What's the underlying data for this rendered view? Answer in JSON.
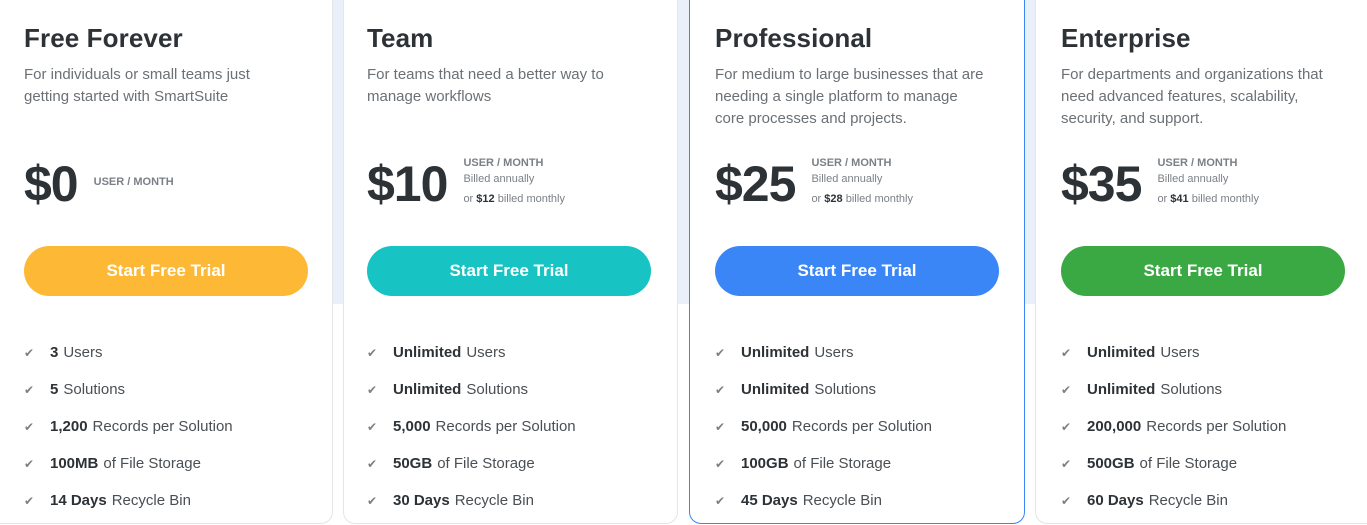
{
  "plans": [
    {
      "name": "Free Forever",
      "description": "For individuals or small teams just getting started with SmartSuite",
      "price": "$0",
      "unit": "USER / MONTH",
      "billed": "",
      "monthly_prefix": "",
      "monthly_price": "",
      "monthly_suffix": "",
      "cta": "Start Free Trial",
      "cta_color": "#fdb835",
      "featured": false,
      "features": [
        {
          "bold": "3",
          "text": "Users"
        },
        {
          "bold": "5",
          "text": "Solutions"
        },
        {
          "bold": "1,200",
          "text": "Records per Solution"
        },
        {
          "bold": "100MB",
          "text": "of File Storage"
        },
        {
          "bold": "14 Days",
          "text": "Recycle Bin"
        }
      ]
    },
    {
      "name": "Team",
      "description": "For teams that need a better way to manage workflows",
      "price": "$10",
      "unit": "USER / MONTH",
      "billed": "Billed annually",
      "monthly_prefix": "or ",
      "monthly_price": "$12",
      "monthly_suffix": " billed monthly",
      "cta": "Start Free Trial",
      "cta_color": "#17c3c3",
      "featured": false,
      "features": [
        {
          "bold": "Unlimited",
          "text": "Users"
        },
        {
          "bold": "Unlimited",
          "text": "Solutions"
        },
        {
          "bold": "5,000",
          "text": "Records per Solution"
        },
        {
          "bold": "50GB",
          "text": "of File Storage"
        },
        {
          "bold": "30 Days",
          "text": "Recycle Bin"
        }
      ]
    },
    {
      "name": "Professional",
      "description": "For medium to large businesses that are needing a single platform to manage core processes and projects.",
      "price": "$25",
      "unit": "USER / MONTH",
      "billed": "Billed annually",
      "monthly_prefix": "or ",
      "monthly_price": "$28",
      "monthly_suffix": " billed monthly",
      "cta": "Start Free Trial",
      "cta_color": "#3b86f7",
      "featured": true,
      "features": [
        {
          "bold": "Unlimited",
          "text": "Users"
        },
        {
          "bold": "Unlimited",
          "text": "Solutions"
        },
        {
          "bold": "50,000",
          "text": "Records per Solution"
        },
        {
          "bold": "100GB",
          "text": "of File Storage"
        },
        {
          "bold": "45 Days",
          "text": "Recycle Bin"
        }
      ]
    },
    {
      "name": "Enterprise",
      "description": "For departments and organizations that need advanced features, scalability, security, and support.",
      "price": "$35",
      "unit": "USER / MONTH",
      "billed": "Billed annually",
      "monthly_prefix": "or ",
      "monthly_price": "$41",
      "monthly_suffix": " billed monthly",
      "cta": "Start Free Trial",
      "cta_color": "#3aa843",
      "featured": false,
      "features": [
        {
          "bold": "Unlimited",
          "text": "Users"
        },
        {
          "bold": "Unlimited",
          "text": "Solutions"
        },
        {
          "bold": "200,000",
          "text": "Records per Solution"
        },
        {
          "bold": "500GB",
          "text": "of File Storage"
        },
        {
          "bold": "60 Days",
          "text": "Recycle Bin"
        }
      ]
    }
  ]
}
